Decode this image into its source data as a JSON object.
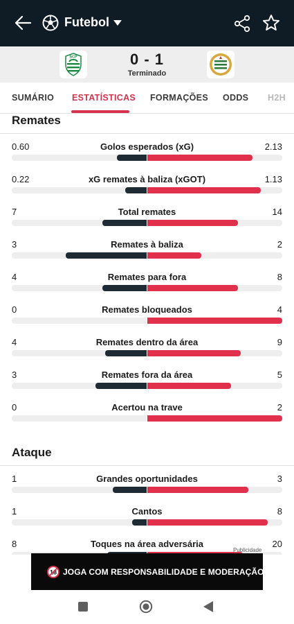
{
  "header": {
    "sport": "Futebol",
    "icons": [
      "back-arrow-icon",
      "football-icon",
      "caret-down-icon",
      "share-icon",
      "star-icon"
    ]
  },
  "match": {
    "score": "0 - 1",
    "status": "Terminado",
    "home_crest_text": "SCP",
    "home_color": "#1a8a43",
    "away_color": "#2a7a3a"
  },
  "tabs": [
    {
      "label": "SUMÁRIO",
      "active": false
    },
    {
      "label": "ESTATÍSTICAS",
      "active": true
    },
    {
      "label": "FORMAÇÕES",
      "active": false
    },
    {
      "label": "ODDS",
      "active": false
    },
    {
      "label": "H2H",
      "active": false
    }
  ],
  "colors": {
    "accent": "#d6324c",
    "home_bar": "#1e2a34",
    "away_bar": "#e0304b",
    "header_bg": "#0f1c26"
  },
  "sections": [
    {
      "title": "Remates",
      "rows": [
        {
          "label": "Golos esperados (xG)",
          "home": "0.60",
          "away": "2.13",
          "home_pct": 22,
          "away_pct": 78
        },
        {
          "label": "xG remates à baliza (xGOT)",
          "home": "0.22",
          "away": "1.13",
          "home_pct": 16,
          "away_pct": 84
        },
        {
          "label": "Total remates",
          "home": "7",
          "away": "14",
          "home_pct": 33,
          "away_pct": 67
        },
        {
          "label": "Remates à baliza",
          "home": "3",
          "away": "2",
          "home_pct": 60,
          "away_pct": 40
        },
        {
          "label": "Remates para fora",
          "home": "4",
          "away": "8",
          "home_pct": 33,
          "away_pct": 67
        },
        {
          "label": "Remates bloqueados",
          "home": "0",
          "away": "4",
          "home_pct": 0,
          "away_pct": 100
        },
        {
          "label": "Remates dentro da área",
          "home": "4",
          "away": "9",
          "home_pct": 31,
          "away_pct": 69
        },
        {
          "label": "Remates fora da área",
          "home": "3",
          "away": "5",
          "home_pct": 38,
          "away_pct": 62
        },
        {
          "label": "Acertou na trave",
          "home": "0",
          "away": "2",
          "home_pct": 0,
          "away_pct": 100
        }
      ]
    },
    {
      "title": "Ataque",
      "rows": [
        {
          "label": "Grandes oportunidades",
          "home": "1",
          "away": "3",
          "home_pct": 25,
          "away_pct": 75
        },
        {
          "label": "Cantos",
          "home": "1",
          "away": "8",
          "home_pct": 11,
          "away_pct": 89
        },
        {
          "label": "Toques na área adversária",
          "home": "8",
          "away": "20",
          "home_pct": 29,
          "away_pct": 71
        }
      ]
    }
  ],
  "ad": {
    "label": "Publicidade",
    "badge": "18",
    "text": "JOGA COM RESPONSABILIDADE E MODERAÇÃO"
  },
  "navbar": {
    "icons": [
      "recent-apps-icon",
      "home-icon",
      "back-icon"
    ]
  }
}
